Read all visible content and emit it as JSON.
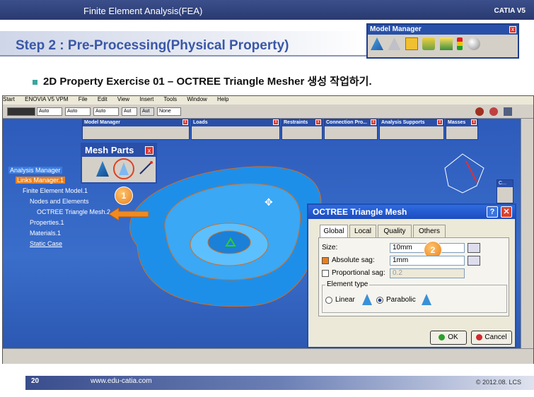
{
  "slide": {
    "header_title": "Finite Element Analysis(FEA)",
    "header_right": "CATIA V5",
    "step_title": "Step 2 : Pre-Processing(Physical Property)",
    "bullet_text": "2D Property Exercise 01 – OCTREE Triangle Mesher",
    "bullet_text_kr": " 생성 작업하기.",
    "page_number": "20",
    "website": "www.edu-catia.com",
    "copyright": "© 2012.08. LCS"
  },
  "model_manager_popup": {
    "title": "Model Manager"
  },
  "app": {
    "menu": [
      "Start",
      "ENOVIA V5 VPM",
      "File",
      "Edit",
      "View",
      "Insert",
      "Tools",
      "Window",
      "Help"
    ],
    "combos": [
      "Auto",
      "Auto",
      "Auto",
      "Aut",
      "Aut",
      "None"
    ],
    "toolbars": [
      {
        "title": "Model Manager"
      },
      {
        "title": "Loads"
      },
      {
        "title": "Restraints"
      },
      {
        "title": "Connection Pro..."
      },
      {
        "title": "Analysis Supports"
      },
      {
        "title": "Masses"
      }
    ],
    "mesh_parts_title": "Mesh Parts",
    "side_mini_toolbar": "C...",
    "tree": [
      {
        "label": "Analysis Manager"
      },
      {
        "label": "Links Manager.1"
      },
      {
        "label": "Finite Element Model.1"
      },
      {
        "label": "Nodes and Elements"
      },
      {
        "label": "OCTREE Triangle Mesh.2"
      },
      {
        "label": "Properties.1"
      },
      {
        "label": "Materials.1"
      },
      {
        "label": "Static Case"
      }
    ],
    "callouts": [
      "1",
      "2"
    ]
  },
  "dialog": {
    "title": "OCTREE Triangle Mesh",
    "help": "?",
    "tabs": [
      "Global",
      "Local",
      "Quality",
      "Others"
    ],
    "size_label": "Size:",
    "size_value": "10mm",
    "abs_sag_label": "Absolute sag:",
    "abs_sag_value": "1mm",
    "prop_sag_label": "Proportional sag:",
    "prop_sag_value": "0.2",
    "element_type_label": "Element type",
    "linear_label": "Linear",
    "parabolic_label": "Parabolic",
    "ok_label": "OK",
    "cancel_label": "Cancel"
  },
  "colors": {
    "accent": "#3a58a8",
    "viewport": "#2d5bbb",
    "orange": "#e8801f"
  }
}
